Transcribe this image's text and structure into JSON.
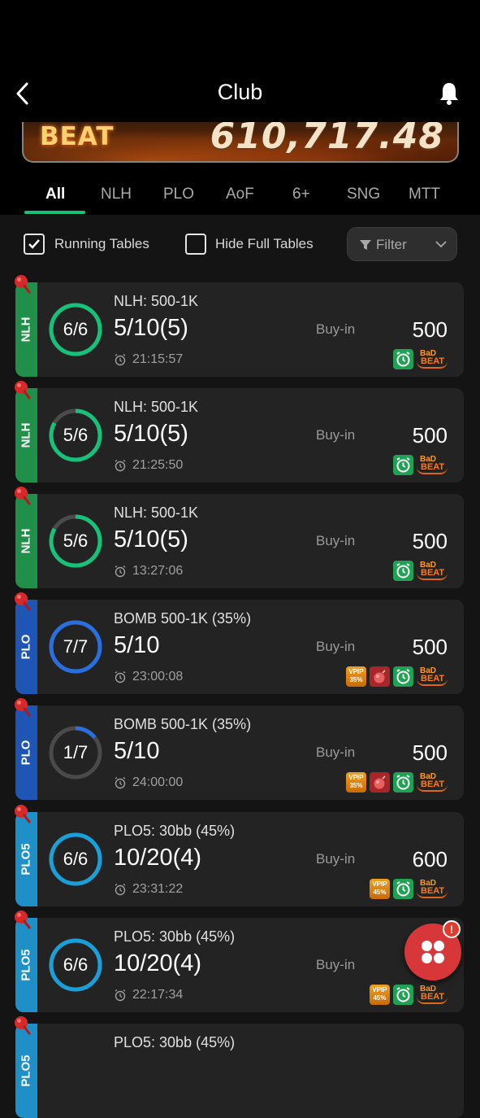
{
  "header": {
    "title": "Club"
  },
  "banner": {
    "logo_text": "BEAT",
    "jackpot_amount": "610,717.48"
  },
  "tabs": [
    {
      "label": "All",
      "active": true
    },
    {
      "label": "NLH"
    },
    {
      "label": "PLO"
    },
    {
      "label": "AoF"
    },
    {
      "label": "6+"
    },
    {
      "label": "SNG"
    },
    {
      "label": "MTT"
    }
  ],
  "filters": {
    "running_tables": {
      "label": "Running Tables",
      "checked": true
    },
    "hide_full_tables": {
      "label": "Hide Full Tables",
      "checked": false
    },
    "filter_button": {
      "label": "Filter"
    }
  },
  "colors": {
    "nlh": "#1f8f4a",
    "plo": "#1f55b5",
    "plo5": "#1f8fc8",
    "accent": "#16c27a",
    "fab": "#d8373a"
  },
  "tables": [
    {
      "type": "NLH",
      "seats": "6/6",
      "fill": 1.0,
      "game": "NLH: 500-1K",
      "stakes": "5/10(5)",
      "time": "21:15:57",
      "buyin_label": "Buy-in",
      "buyin": "500",
      "badges": [
        "alarm",
        "badbeat"
      ]
    },
    {
      "type": "NLH",
      "seats": "5/6",
      "fill": 0.833,
      "game": "NLH: 500-1K",
      "stakes": "5/10(5)",
      "time": "21:25:50",
      "buyin_label": "Buy-in",
      "buyin": "500",
      "badges": [
        "alarm",
        "badbeat"
      ]
    },
    {
      "type": "NLH",
      "seats": "5/6",
      "fill": 0.833,
      "game": "NLH: 500-1K",
      "stakes": "5/10(5)",
      "time": "13:27:06",
      "buyin_label": "Buy-in",
      "buyin": "500",
      "badges": [
        "alarm",
        "badbeat"
      ]
    },
    {
      "type": "PLO",
      "seats": "7/7",
      "fill": 1.0,
      "game": "BOMB 500-1K (35%)",
      "stakes": "5/10",
      "time": "23:00:08",
      "buyin_label": "Buy-in",
      "buyin": "500",
      "badges": [
        "vpip35",
        "bomb",
        "alarm",
        "badbeat"
      ]
    },
    {
      "type": "PLO",
      "seats": "1/7",
      "fill": 0.143,
      "game": "BOMB 500-1K (35%)",
      "stakes": "5/10",
      "time": "24:00:00",
      "buyin_label": "Buy-in",
      "buyin": "500",
      "badges": [
        "vpip35",
        "bomb",
        "alarm",
        "badbeat"
      ]
    },
    {
      "type": "PLO5",
      "seats": "6/6",
      "fill": 1.0,
      "game": "PLO5: 30bb (45%)",
      "stakes": "10/20(4)",
      "time": "23:31:22",
      "buyin_label": "Buy-in",
      "buyin": "600",
      "badges": [
        "vpip45",
        "alarm",
        "badbeat"
      ]
    },
    {
      "type": "PLO5",
      "seats": "6/6",
      "fill": 1.0,
      "game": "PLO5: 30bb (45%)",
      "stakes": "10/20(4)",
      "time": "22:17:34",
      "buyin_label": "Buy-in",
      "buyin": "",
      "badges": [
        "vpip45",
        "alarm",
        "badbeat"
      ]
    },
    {
      "type": "PLO5",
      "seats": "",
      "fill": 0,
      "game": "PLO5: 30bb (45%)",
      "stakes": "",
      "time": "",
      "buyin_label": "",
      "buyin": "",
      "badges": []
    }
  ],
  "badge_text": {
    "vpip": "VPIP",
    "vpip35": "35%",
    "vpip45": "45%",
    "bad": "BaD",
    "beat": "BEAT"
  },
  "fab": {
    "notification": "!"
  }
}
